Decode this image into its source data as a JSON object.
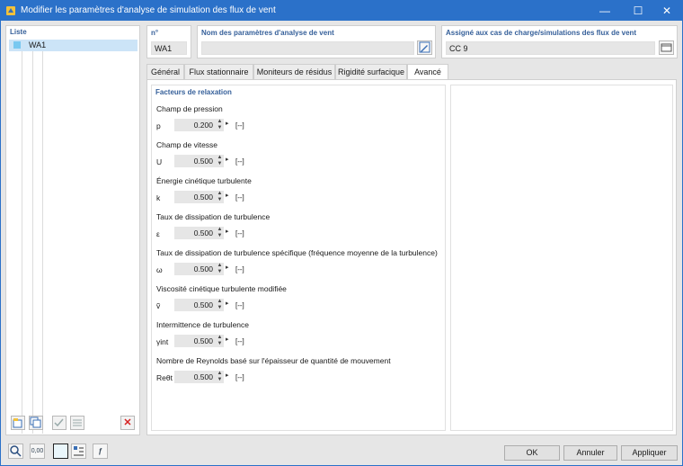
{
  "window": {
    "title": "Modifier les paramètres d'analyse de simulation des flux de vent",
    "minimize_icon": "—",
    "maximize_icon": "☐",
    "close_icon": "✕"
  },
  "list": {
    "header": "Liste",
    "items": [
      {
        "label": "WA1",
        "color": "#79c8f0"
      }
    ],
    "toolbar_icons": [
      "new-icon",
      "copy-icon",
      "check-icon",
      "uncheck-icon",
      "delete-icon"
    ],
    "delete_glyph": "✕"
  },
  "fields": {
    "number_label": "n°",
    "number_value": "WA1",
    "name_label": "Nom des paramètres d'analyse de vent",
    "name_value": "",
    "assigned_label": "Assigné aux cas de charge/simulations des flux de vent",
    "assigned_value": "CC 9"
  },
  "tabs": [
    {
      "label": "Général"
    },
    {
      "label": "Flux stationnaire"
    },
    {
      "label": "Moniteurs de résidus"
    },
    {
      "label": "Rigidité surfacique"
    },
    {
      "label": "Avancé"
    }
  ],
  "section": {
    "title": "Facteurs de relaxation",
    "params": [
      {
        "name": "Champ de pression",
        "symbol": "p",
        "value": "0.200",
        "unit": "[--]"
      },
      {
        "name": "Champ de vitesse",
        "symbol": "U",
        "value": "0.500",
        "unit": "[--]"
      },
      {
        "name": "Énergie cinétique turbulente",
        "symbol": "k",
        "value": "0.500",
        "unit": "[--]"
      },
      {
        "name": "Taux de dissipation de turbulence",
        "symbol": "ε",
        "value": "0.500",
        "unit": "[--]"
      },
      {
        "name": "Taux de dissipation de turbulence spécifique (fréquence moyenne de la turbulence)",
        "symbol": "ω",
        "value": "0.500",
        "unit": "[--]"
      },
      {
        "name": "Viscosité cinétique turbulente modifiée",
        "symbol": "ṽ",
        "value": "0.500",
        "unit": "[--]"
      },
      {
        "name": "Intermittence de turbulence",
        "symbol": "γint",
        "value": "0.500",
        "unit": "[--]"
      },
      {
        "name": "Nombre de Reynolds basé sur l'épaisseur de quantité de mouvement",
        "symbol": "Reθt",
        "value": "0.500",
        "unit": "[--]"
      }
    ],
    "spin_up": "▲",
    "spin_down": "▼",
    "arrow": "▸"
  },
  "bottom": {
    "ok_label": "OK",
    "cancel_label": "Annuler",
    "apply_label": "Appliquer",
    "number_icon_text": "0,00",
    "function_icon_text": "ƒ"
  }
}
